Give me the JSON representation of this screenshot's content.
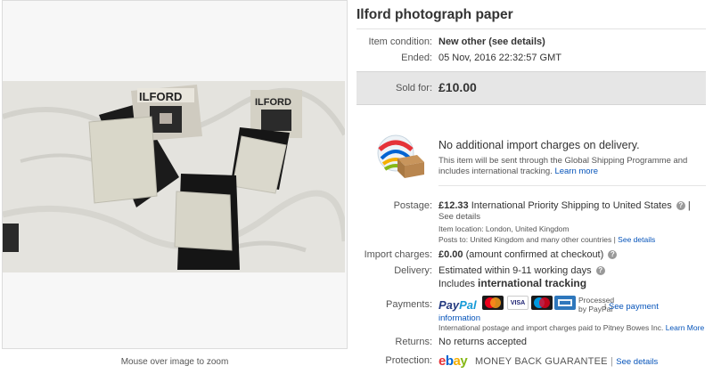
{
  "image_panel": {
    "zoom_hint": "Mouse over image to zoom",
    "photo_labels": [
      "ILFORD",
      "ILFORD"
    ]
  },
  "listing": {
    "title": "Ilford photograph paper",
    "condition_label": "Item condition:",
    "condition_value": "New other (see details)",
    "ended_label": "Ended:",
    "ended_value": "05 Nov, 2016  22:32:57 GMT",
    "sold_label": "Sold for:",
    "sold_value": "£10.00"
  },
  "shipping_programme": {
    "title": "No additional import charges on delivery.",
    "text": "This item will be sent through the Global Shipping Programme and includes international tracking.",
    "learn_more": "Learn more"
  },
  "postage": {
    "label": "Postage:",
    "price": "£12.33",
    "service": "International Priority Shipping to United States",
    "separator": "|",
    "see_details": "See details",
    "item_location": "Item location:  London, United Kingdom",
    "posts_to": "Posts to:  United Kingdom and many other countries",
    "posts_to_sep": "|",
    "posts_to_link": "See details"
  },
  "import_charges": {
    "label": "Import charges:",
    "value": "£0.00",
    "note": "(amount confirmed at checkout)"
  },
  "delivery": {
    "label": "Delivery:",
    "estimate": "Estimated within 9-11 working days",
    "includes": "Includes",
    "tracking": "international tracking"
  },
  "payments": {
    "label": "Payments:",
    "paypal_a": "Pay",
    "paypal_b": "Pal",
    "cards": [
      "MasterCard",
      "VISA",
      "Maestro",
      "AMEX"
    ],
    "processed_line1": "Processed",
    "processed_line2": "by PayPal",
    "separator": "|",
    "see_payment": "See payment",
    "information": "information",
    "note": "International postage and import charges paid to Pitney Bowes Inc.",
    "learn_more": "Learn More"
  },
  "returns": {
    "label": "Returns:",
    "value": "No returns accepted"
  },
  "protection": {
    "label": "Protection:",
    "logo": [
      "e",
      "b",
      "a",
      "y"
    ],
    "guarantee": "MONEY BACK GUARANTEE",
    "separator": "|",
    "see_details": "See details"
  },
  "help_icon": "?",
  "colors": {
    "link": "#0654ba",
    "sold_bar": "#e6e6e6",
    "ebay_red": "#e53238",
    "ebay_blue": "#0064d2",
    "ebay_yellow": "#f5af02",
    "ebay_green": "#86b817",
    "paypal_dark": "#253b80",
    "paypal_light": "#179bd7"
  },
  "icons": [
    "help-icon",
    "global-shipping-icon",
    "paypal-logo",
    "mastercard-logo",
    "visa-logo",
    "maestro-logo",
    "amex-logo",
    "ebay-logo"
  ]
}
